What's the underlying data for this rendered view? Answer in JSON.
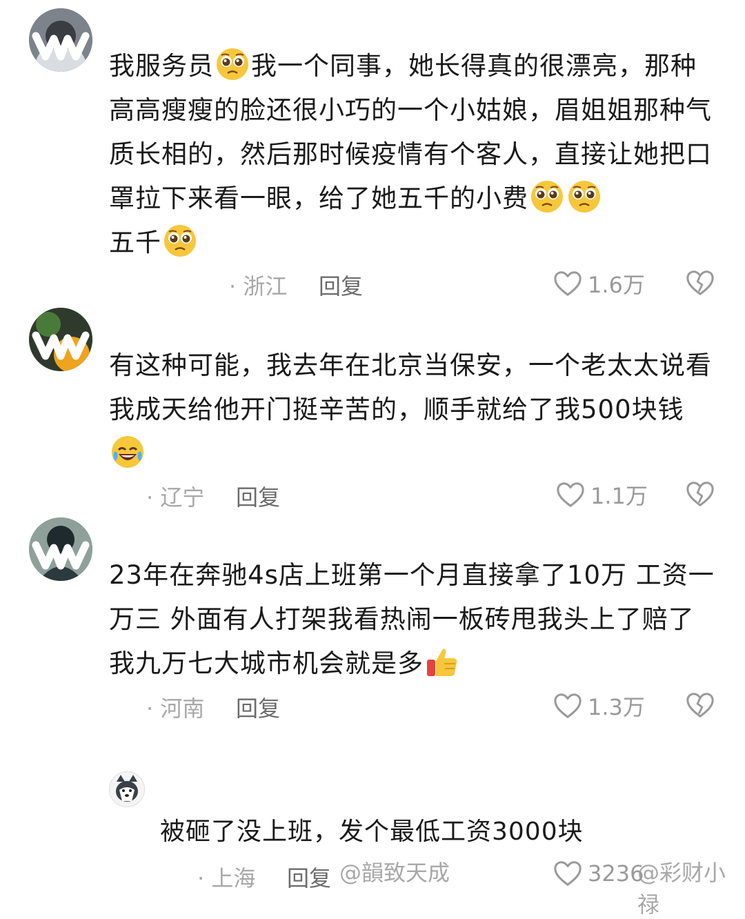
{
  "comments": [
    {
      "text_before": "我服务员",
      "text_middle": "我一个同事，她长得真的很漂亮，那种高高瘦瘦的脸还很小巧的一个小姑娘，眉姐姐那种气质长相的，然后那时候疫情有个客人，直接让她把口罩拉下来看一眼，给了她五千的小费",
      "text_end": "五千",
      "location": "· 浙江",
      "reply_label": "回复",
      "likes": "1.6万"
    },
    {
      "text": "有这种可能，我去年在北京当保安，一个老太太说看我成天给他开门挺辛苦的，顺手就给了我500块钱",
      "location": "· 辽宁",
      "reply_label": "回复",
      "likes": "1.1万"
    },
    {
      "text": "23年在奔驰4s店上班第一个月直接拿了10万 工资一万三 外面有人打架我看热闹一板砖甩我头上了赔了我九万七大城市机会就是多",
      "location": "· 河南",
      "reply_label": "回复",
      "likes": "1.3万"
    }
  ],
  "reply": {
    "text": "被砸了没上班，发个最低工资3000块",
    "location": "· 上海",
    "reply_label": "回复",
    "likes": "3236"
  },
  "watermarks": {
    "left": "@韻致天成",
    "right": "@彩财小禄"
  },
  "icons": {
    "like": "heart-outline-icon",
    "dislike": "broken-heart-icon",
    "emoji_pleading": "pleading-face-emoji",
    "emoji_laughing": "rofl-emoji",
    "emoji_thumbs": "thumbs-up-emoji"
  },
  "colors": {
    "text": "#1a1a1a",
    "meta": "#a8a8a8",
    "reply": "#6b6b6b",
    "like": "#9a9a9a"
  }
}
